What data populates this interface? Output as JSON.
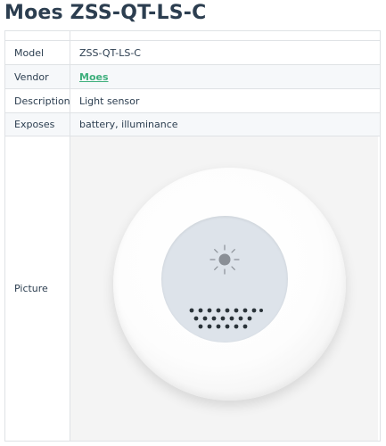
{
  "page": {
    "title": "Moes ZSS-QT-LS-C"
  },
  "table": {
    "rows": [
      {
        "key": "Model",
        "value": "ZSS-QT-LS-C"
      },
      {
        "key": "Vendor",
        "value": "Moes"
      },
      {
        "key": "Description",
        "value": "Light sensor"
      },
      {
        "key": "Exposes",
        "value": "battery, illuminance"
      },
      {
        "key": "Picture",
        "value": ""
      }
    ]
  },
  "picture": {
    "icon": "sun-icon",
    "device_color": "#ffffff",
    "face_color": "#dde3ea"
  },
  "colors": {
    "link": "#3eaf7c",
    "text": "#2c3e50",
    "border": "#dfe2e5"
  }
}
